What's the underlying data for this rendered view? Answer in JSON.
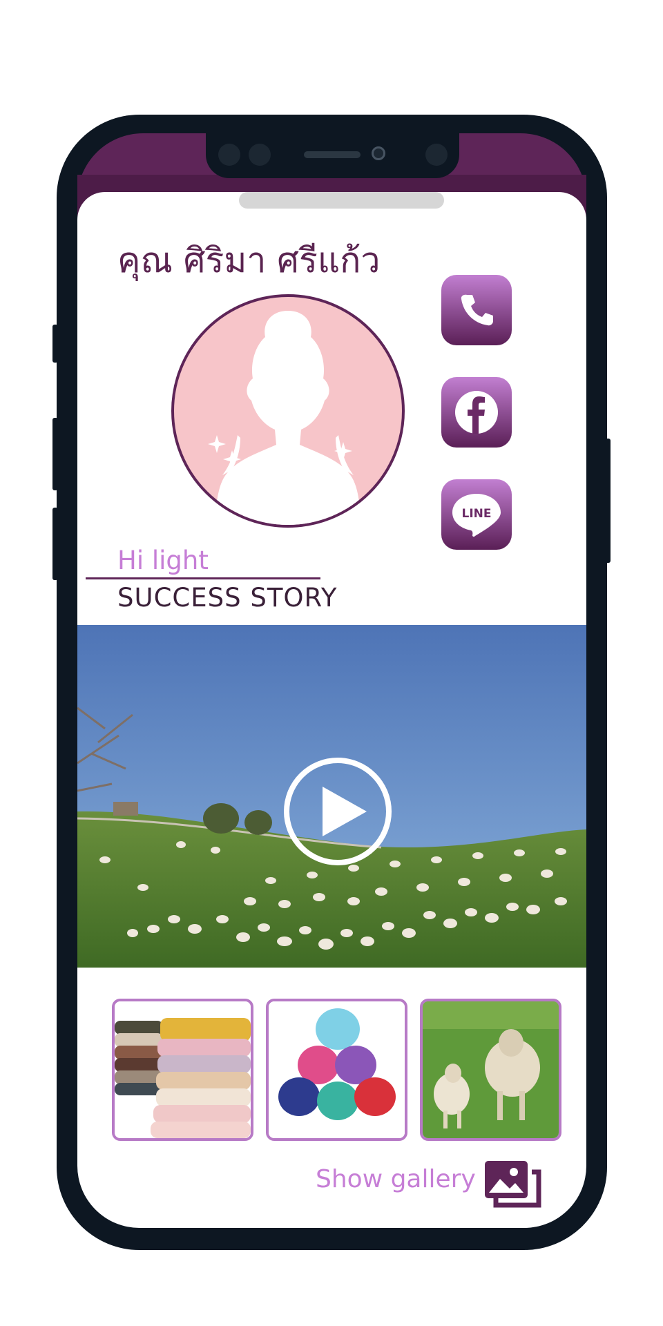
{
  "profile": {
    "name": "คุณ ศิริมา ศรีแก้ว"
  },
  "contacts": [
    {
      "icon": "phone-icon"
    },
    {
      "icon": "facebook-icon"
    },
    {
      "icon": "line-icon",
      "label": "LINE"
    }
  ],
  "highlight": {
    "title": "Hi light",
    "subtitle": "SUCCESS STORY"
  },
  "video": {
    "icon": "play-icon"
  },
  "gallery": {
    "thumbnails": [
      "towels-photo",
      "yarn-photo",
      "sheep-photo"
    ],
    "show_label": "Show gallery",
    "icon": "gallery-icon"
  },
  "colors": {
    "primary": "#5e2558",
    "accent": "#c67ed6",
    "avatar_bg": "#f7c5c9"
  }
}
